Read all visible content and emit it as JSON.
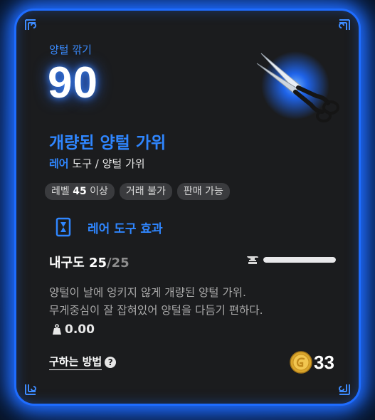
{
  "stat": {
    "label": "양털 깎기",
    "value": "90"
  },
  "item": {
    "name": "개량된 양털 가위",
    "rarity": "레어",
    "category": "도구 / 양털 가위",
    "icon": "blue-glowing-shears-icon"
  },
  "tags": [
    {
      "prefix": "레벨 ",
      "bold": "45",
      "suffix": " 이상"
    },
    {
      "prefix": "거래 불가",
      "bold": "",
      "suffix": ""
    },
    {
      "prefix": "판매 가능",
      "bold": "",
      "suffix": ""
    }
  ],
  "effect": {
    "label": "레어 도구 효과"
  },
  "durability": {
    "label": "내구도 ",
    "current": "25",
    "max": "/25",
    "fraction": 1.0
  },
  "description": {
    "line1": "양털이 날에 엉키지 않게 개량된 양털 가위.",
    "line2": "무게중심이 잘 잡혀있어 양털을 다듬기 편하다."
  },
  "weight": {
    "value": "0.00"
  },
  "howto": {
    "label": "구하는 방법",
    "help": "?"
  },
  "price": {
    "value": "33"
  },
  "colors": {
    "accent": "#2f86ff",
    "border_glow": "#1e6cff",
    "card_bg": "#1b1c1e"
  }
}
